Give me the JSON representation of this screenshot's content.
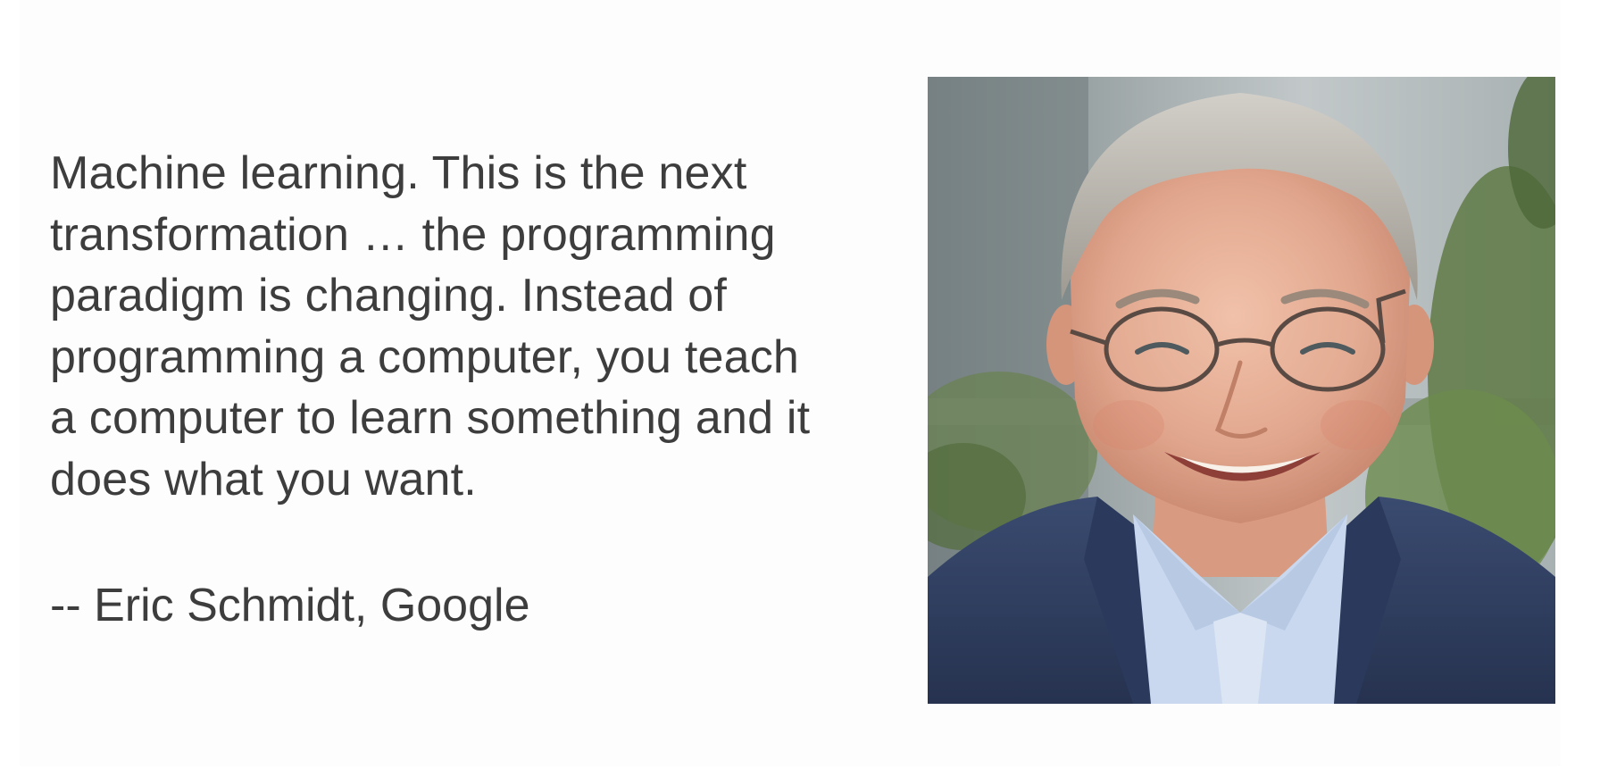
{
  "slide": {
    "quote_lines": [
      "Machine learning. This is the next",
      "transformation … the programming",
      "paradigm is changing. Instead of",
      "programming a computer, you teach",
      "a computer to learn something and it",
      "does what you want."
    ],
    "attribution": "-- Eric Schmidt, Google"
  },
  "portrait": {
    "subject": "smiling man with glasses in dark blue blazer",
    "colors": {
      "background_wall": "#a9b0b2",
      "foliage": "#5f7a45",
      "blazer": "#2f3f62",
      "shirt": "#c9d8ee",
      "skin": "#e2a88f",
      "hair": "#b9b6ae"
    }
  }
}
